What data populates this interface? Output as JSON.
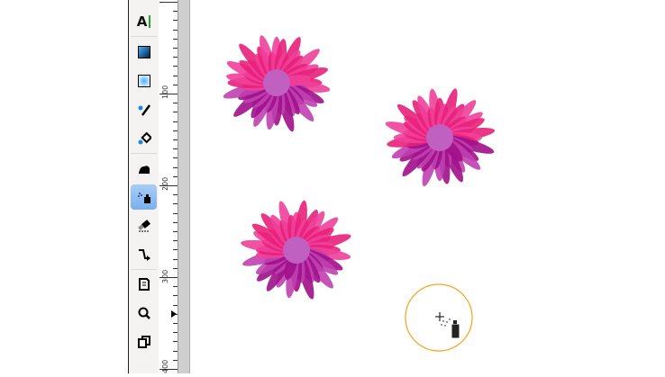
{
  "toolbox": {
    "tools": [
      {
        "name": "text-tool",
        "glyph": "A"
      },
      {
        "name": "gradient-tool",
        "glyph": ""
      },
      {
        "name": "mesh-tool",
        "glyph": ""
      },
      {
        "name": "dropper-tool",
        "glyph": ""
      },
      {
        "name": "paint-bucket-tool",
        "glyph": ""
      },
      {
        "name": "tweak-tool",
        "glyph": ""
      },
      {
        "name": "spray-tool",
        "glyph": "",
        "active": true
      },
      {
        "name": "eraser-tool",
        "glyph": ""
      },
      {
        "name": "connector-tool",
        "glyph": ""
      },
      {
        "name": "document-properties-tool",
        "glyph": ""
      },
      {
        "name": "zoom-tool",
        "glyph": ""
      },
      {
        "name": "pages-tool",
        "glyph": ""
      }
    ]
  },
  "ruler": {
    "labels": [
      "100",
      "200",
      "300",
      "400"
    ]
  },
  "colors": {
    "accent": "#78b0ee",
    "spray_circle": "#f7a21b",
    "petal_light": "#f0409a",
    "petal_dark": "#a0108a",
    "flower_center": "#c060c0"
  }
}
